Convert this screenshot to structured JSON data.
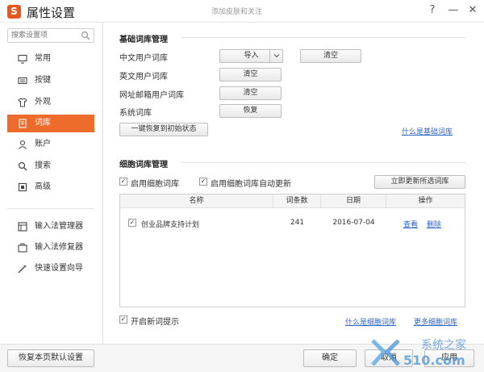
{
  "window": {
    "title": "属性设置",
    "subtitle": "添加皮肤和关注",
    "help": "?",
    "minimize": "—",
    "close": "✕"
  },
  "sidebar": {
    "search_placeholder": "搜索设置项",
    "items": [
      {
        "label": "常用",
        "icon": "monitor-icon"
      },
      {
        "label": "按键",
        "icon": "keyboard-icon"
      },
      {
        "label": "外观",
        "icon": "shirt-icon"
      },
      {
        "label": "词库",
        "icon": "dictionary-icon",
        "active": true
      },
      {
        "label": "账户",
        "icon": "user-icon"
      },
      {
        "label": "搜索",
        "icon": "search-icon"
      },
      {
        "label": "高级",
        "icon": "advanced-icon"
      }
    ],
    "tools": [
      {
        "label": "输入法管理器",
        "icon": "manager-icon"
      },
      {
        "label": "输入法修复器",
        "icon": "repair-icon"
      },
      {
        "label": "快速设置向导",
        "icon": "wizard-icon"
      }
    ]
  },
  "basic": {
    "title": "基础词库管理",
    "rows": [
      {
        "label": "中文用户词库",
        "button": "导入",
        "button2": "清空"
      },
      {
        "label": "英文用户词库",
        "button": "清空"
      },
      {
        "label": "网址邮箱用户词库",
        "button": "清空"
      },
      {
        "label": "系统词库",
        "button": "恢复"
      }
    ],
    "reset_button": "一键恢复到初始状态",
    "help_link": "什么是基础词库"
  },
  "cell": {
    "title": "细胞词库管理",
    "enable_label": "启用细胞词库",
    "auto_update_label": "启用细胞词库自动更新",
    "update_button": "立即更新所选词库",
    "columns": [
      "名称",
      "词条数",
      "日期",
      "操作"
    ],
    "rows": [
      {
        "name": "创业品牌支持计划",
        "count": "241",
        "date": "2016-07-04",
        "view": "查看",
        "delete": "删除"
      }
    ],
    "new_word_tip": "开启新词提示",
    "help_link": "什么是细胞词库",
    "more_link": "更多细胞词库"
  },
  "footer": {
    "restore_button": "恢复本页默认设置",
    "ok_button": "确定",
    "cancel_button": "取消",
    "apply_button": "应用"
  },
  "watermark": {
    "brand": "系统之家",
    "site": "510.com"
  },
  "colors": {
    "accent": "#ed6b2b",
    "link": "#2f66c2"
  }
}
